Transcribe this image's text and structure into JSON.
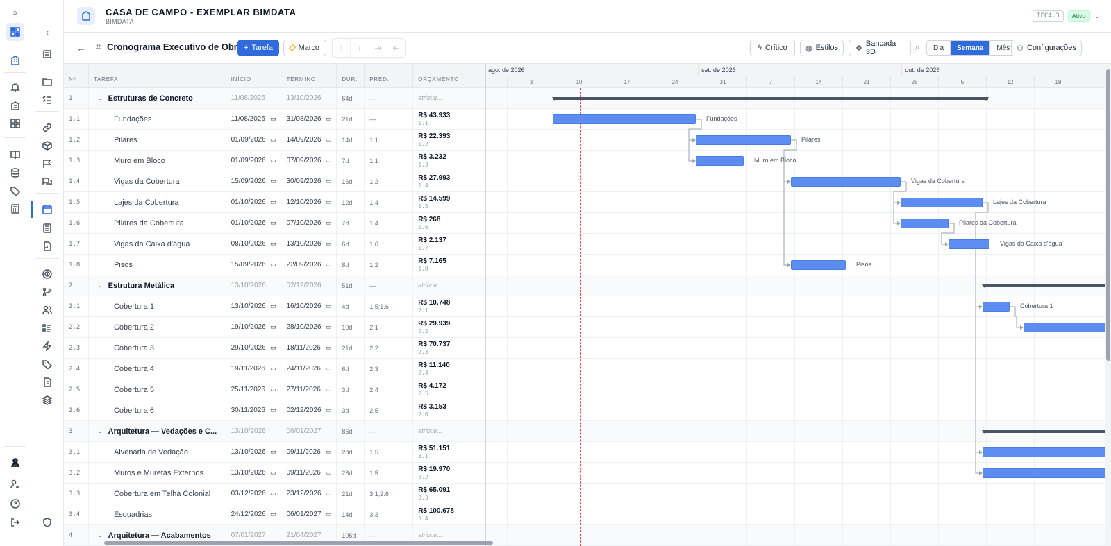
{
  "header": {
    "title": "CASA DE CAMPO - EXEMPLAR BIMDATA",
    "subtitle": "BIMDATA",
    "ifc_badge": "IFC4.3",
    "status_badge": "Ativo"
  },
  "toolbar": {
    "hash": "#",
    "title": "Cronograma Executivo de Obra",
    "tarefa_label": "Tarefa",
    "marco_label": "Marco",
    "critico_label": "Crítico",
    "estilos_label": "Estilos",
    "bancada_label": "Bancada 3D",
    "view_dia": "Dia",
    "view_semana": "Semana",
    "view_mes": "Mês",
    "config_label": "Configurações"
  },
  "table": {
    "headers": {
      "no": "Nº",
      "task": "TAREFA",
      "start": "INÍCIO",
      "end": "TÉRMINO",
      "dur": "DUR.",
      "pred": "PRED.",
      "budget": "ORÇAMENTO"
    },
    "rows": [
      {
        "no": "1",
        "name": "Estruturas de Concreto",
        "start": "11/08/2026",
        "end": "13/10/2026",
        "dur": "64d",
        "pred": "—",
        "budget": "atribuir...",
        "sub": "",
        "parent": true
      },
      {
        "no": "1.1",
        "name": "Fundações",
        "start": "11/08/2026",
        "end": "31/08/2026",
        "dur": "21d",
        "pred": "—",
        "budget": "R$ 43.933",
        "sub": "1.1",
        "parent": false
      },
      {
        "no": "1.2",
        "name": "Pilares",
        "start": "01/09/2026",
        "end": "14/09/2026",
        "dur": "14d",
        "pred": "1.1",
        "budget": "R$ 22.393",
        "sub": "1.2",
        "parent": false
      },
      {
        "no": "1.3",
        "name": "Muro em Bloco",
        "start": "01/09/2026",
        "end": "07/09/2026",
        "dur": "7d",
        "pred": "1.1",
        "budget": "R$ 3.232",
        "sub": "1.3",
        "parent": false
      },
      {
        "no": "1.4",
        "name": "Vigas da Cobertura",
        "start": "15/09/2026",
        "end": "30/09/2026",
        "dur": "16d",
        "pred": "1.2",
        "budget": "R$ 27.993",
        "sub": "1.4",
        "parent": false
      },
      {
        "no": "1.5",
        "name": "Lajes da Cobertura",
        "start": "01/10/2026",
        "end": "12/10/2026",
        "dur": "12d",
        "pred": "1.4",
        "budget": "R$ 14.599",
        "sub": "1.5",
        "parent": false
      },
      {
        "no": "1.6",
        "name": "Pilares da Cobertura",
        "start": "01/10/2026",
        "end": "07/10/2026",
        "dur": "7d",
        "pred": "1.4",
        "budget": "R$ 268",
        "sub": "1.6",
        "parent": false
      },
      {
        "no": "1.7",
        "name": "Vigas da Caixa d'água",
        "start": "08/10/2026",
        "end": "13/10/2026",
        "dur": "6d",
        "pred": "1.6",
        "budget": "R$ 2.137",
        "sub": "1.7",
        "parent": false
      },
      {
        "no": "1.8",
        "name": "Pisos",
        "start": "15/09/2026",
        "end": "22/09/2026",
        "dur": "8d",
        "pred": "1.2",
        "budget": "R$ 7.165",
        "sub": "1.8",
        "parent": false
      },
      {
        "no": "2",
        "name": "Estrutura Metálica",
        "start": "13/10/2026",
        "end": "02/12/2026",
        "dur": "51d",
        "pred": "—",
        "budget": "atribuir...",
        "sub": "",
        "parent": true
      },
      {
        "no": "2.1",
        "name": "Cobertura 1",
        "start": "13/10/2026",
        "end": "16/10/2026",
        "dur": "4d",
        "pred": "1.5;1.6",
        "budget": "R$ 10.748",
        "sub": "2.1",
        "parent": false
      },
      {
        "no": "2.2",
        "name": "Cobertura 2",
        "start": "19/10/2026",
        "end": "28/10/2026",
        "dur": "10d",
        "pred": "2.1",
        "budget": "R$ 29.939",
        "sub": "2.2",
        "parent": false
      },
      {
        "no": "2.3",
        "name": "Cobertura 3",
        "start": "29/10/2026",
        "end": "18/11/2026",
        "dur": "21d",
        "pred": "2.2",
        "budget": "R$ 70.737",
        "sub": "2.3",
        "parent": false
      },
      {
        "no": "2.4",
        "name": "Cobertura 4",
        "start": "19/11/2026",
        "end": "24/11/2026",
        "dur": "6d",
        "pred": "2.3",
        "budget": "R$ 11.140",
        "sub": "2.4",
        "parent": false
      },
      {
        "no": "2.5",
        "name": "Cobertura 5",
        "start": "25/11/2026",
        "end": "27/11/2026",
        "dur": "3d",
        "pred": "2.4",
        "budget": "R$ 4.172",
        "sub": "2.5",
        "parent": false
      },
      {
        "no": "2.6",
        "name": "Cobertura 6",
        "start": "30/11/2026",
        "end": "02/12/2026",
        "dur": "3d",
        "pred": "2.5",
        "budget": "R$ 3.153",
        "sub": "2.6",
        "parent": false
      },
      {
        "no": "3",
        "name": "Arquitetura — Vedações e C...",
        "start": "13/10/2026",
        "end": "06/01/2027",
        "dur": "86d",
        "pred": "—",
        "budget": "atribuir...",
        "sub": "",
        "parent": true
      },
      {
        "no": "3.1",
        "name": "Alvenaria de Vedação",
        "start": "13/10/2026",
        "end": "09/11/2026",
        "dur": "28d",
        "pred": "1.5",
        "budget": "R$ 51.151",
        "sub": "3.1",
        "parent": false
      },
      {
        "no": "3.2",
        "name": "Muros e Muretas Externos",
        "start": "13/10/2026",
        "end": "09/11/2026",
        "dur": "28d",
        "pred": "1.5",
        "budget": "R$ 19.970",
        "sub": "3.2",
        "parent": false
      },
      {
        "no": "3.3",
        "name": "Cobertura em Telha Colonial",
        "start": "03/12/2026",
        "end": "23/12/2026",
        "dur": "21d",
        "pred": "3.1;2.6",
        "budget": "R$ 65.091",
        "sub": "3.3",
        "parent": false
      },
      {
        "no": "3.4",
        "name": "Esquadrias",
        "start": "24/12/2026",
        "end": "06/01/2027",
        "dur": "14d",
        "pred": "3.3",
        "budget": "R$ 100.678",
        "sub": "3.4",
        "parent": false
      },
      {
        "no": "4",
        "name": "Arquitetura — Acabamentos",
        "start": "07/01/2027",
        "end": "21/04/2027",
        "dur": "105d",
        "pred": "—",
        "budget": "atribuir...",
        "sub": "",
        "parent": true
      }
    ]
  },
  "gantt": {
    "months": [
      "ago. de 2026",
      "set. de 2026",
      "out. de 2026"
    ],
    "weeks": [
      "3",
      "10",
      "17",
      "24",
      "31",
      "7",
      "14",
      "21",
      "28",
      "5",
      "12",
      "19"
    ],
    "bar_color": "#5b8ef0",
    "today_color": "#ef4444",
    "today_week_index": 1.55,
    "bar_labels": [
      "Fundações",
      "Pilares",
      "Muro em Bloco",
      "Vigas da Cobertura",
      "Lajes da Cobertura",
      "Pilares da Cobertura",
      "Vigas da Caixa d'água",
      "Pisos",
      "Cobertura 1"
    ]
  },
  "colors": {
    "accent": "#2f6bdc",
    "active_badge": "#15803d"
  }
}
